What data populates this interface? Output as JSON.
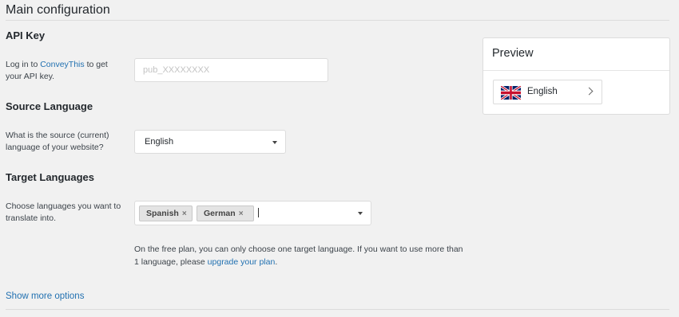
{
  "header": {
    "title": "Main configuration"
  },
  "api_key": {
    "title": "API Key",
    "desc_prefix": "Log in to ",
    "desc_link": "ConveyThis",
    "desc_suffix": " to get your API key.",
    "placeholder": "pub_XXXXXXXX",
    "value": ""
  },
  "source_language": {
    "title": "Source Language",
    "desc": "What is the source (current) language of your website?",
    "selected": "English"
  },
  "target_languages": {
    "title": "Target Languages",
    "desc": "Choose languages you want to translate into.",
    "chips": [
      {
        "label": "Spanish",
        "remove": "×"
      },
      {
        "label": "German",
        "remove": "×"
      }
    ],
    "note_prefix": "On the free plan, you can only choose one target language. If you want to use more than 1 language, please ",
    "note_link": "upgrade your plan",
    "note_suffix": "."
  },
  "show_more": "Show more options",
  "preview": {
    "title": "Preview",
    "language": "English",
    "flag_icon": "uk-flag-icon"
  },
  "colors": {
    "link": "#2271b1",
    "background": "#f1f1f1",
    "flag_blue": "#012169",
    "flag_red": "#C8102E"
  }
}
